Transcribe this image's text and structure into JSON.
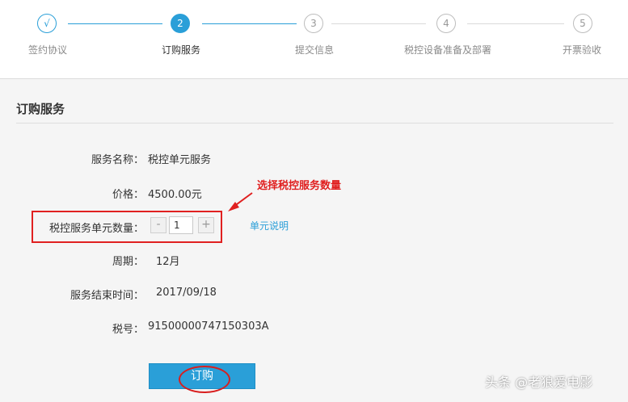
{
  "steps": [
    {
      "index": "√",
      "label": "签约协议",
      "state": "done"
    },
    {
      "index": "2",
      "label": "订购服务",
      "state": "active"
    },
    {
      "index": "3",
      "label": "提交信息",
      "state": "todo"
    },
    {
      "index": "4",
      "label": "税控设备准备及部署",
      "state": "todo"
    },
    {
      "index": "5",
      "label": "开票验收",
      "state": "todo"
    }
  ],
  "panel": {
    "title": "订购服务",
    "service_name_label": "服务名称：",
    "service_name_value": "税控单元服务",
    "price_label": "价格：",
    "price_value": "4500.00元",
    "quantity_label": "税控服务单元数量：",
    "quantity_minus": "-",
    "quantity_value": "1",
    "quantity_plus": "+",
    "unit_link": "单元说明",
    "period_label": "周期：",
    "period_value": "12月",
    "end_time_label": "服务结束时间：",
    "end_time_value": "2017/09/18",
    "tax_id_label": "税号：",
    "tax_id_value": "91500000747150303A",
    "buy_button": "订购"
  },
  "annotation": {
    "text": "选择税控服务数量"
  },
  "watermark": "头条 @老狼爱电影",
  "colors": {
    "accent": "#2a9fd8",
    "annotation": "#e02020"
  }
}
